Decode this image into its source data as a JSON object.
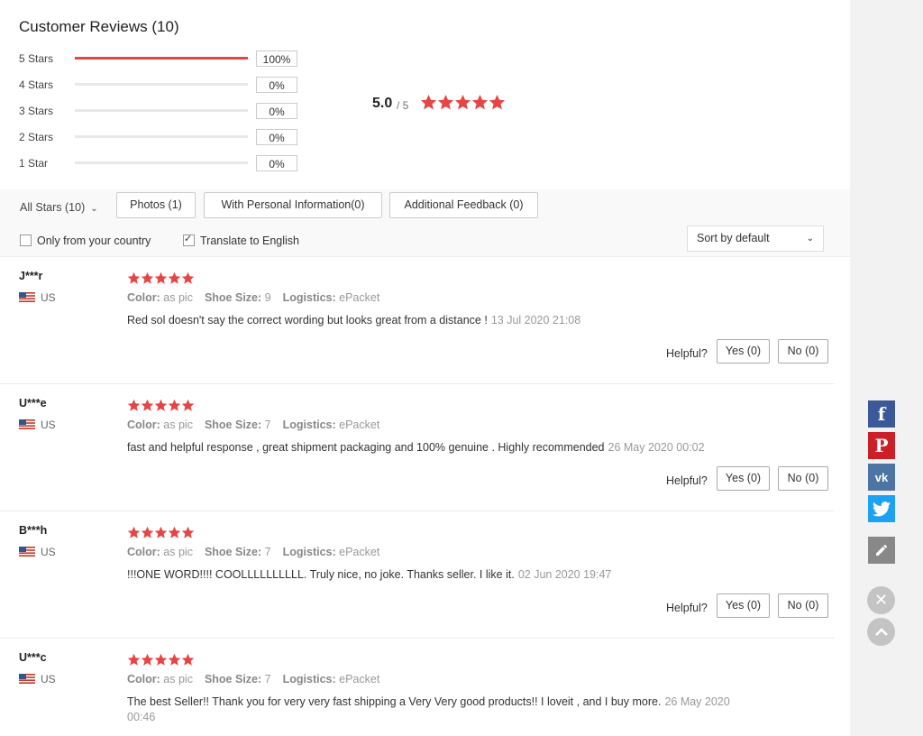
{
  "summary": {
    "title": "Customer Reviews (10)",
    "distribution": [
      {
        "label": "5 Stars",
        "percent_text": "100%",
        "fraction": 1.0
      },
      {
        "label": "4 Stars",
        "percent_text": "0%",
        "fraction": 0
      },
      {
        "label": "3 Stars",
        "percent_text": "0%",
        "fraction": 0
      },
      {
        "label": "2 Stars",
        "percent_text": "0%",
        "fraction": 0
      },
      {
        "label": "1 Star",
        "percent_text": "0%",
        "fraction": 0
      }
    ],
    "average": "5.0",
    "out_of": "/ 5",
    "star_rating": 5
  },
  "filters": {
    "all_stars": "All Stars (10)",
    "photos": "Photos (1)",
    "personal_info": "With Personal Information(0)",
    "additional_feedback": "Additional Feedback (0)",
    "only_country": "Only from your country",
    "only_country_checked": false,
    "translate": "Translate to English",
    "translate_checked": true,
    "sort": "Sort by default"
  },
  "labels": {
    "color": "Color:",
    "shoe_size": "Shoe Size:",
    "logistics": "Logistics:",
    "helpful": "Helpful?"
  },
  "reviews": [
    {
      "name": "J***r",
      "country": "US",
      "color": "as pic",
      "shoe_size": "9",
      "logistics": "ePacket",
      "text": "Red sol doesn't say the correct wording but looks great from a distance !",
      "date": "13 Jul 2020 21:08",
      "yes": "Yes (0)",
      "no": "No (0)"
    },
    {
      "name": "U***e",
      "country": "US",
      "color": "as pic",
      "shoe_size": "7",
      "logistics": "ePacket",
      "text": "fast and helpful response , great shipment packaging and 100% genuine . Highly recommended",
      "date": "26 May 2020 00:02",
      "yes": "Yes (0)",
      "no": "No (0)"
    },
    {
      "name": "B***h",
      "country": "US",
      "color": "as pic",
      "shoe_size": "7",
      "logistics": "ePacket",
      "text": "!!!ONE WORD!!!! COOLLLLLLLLLL. Truly nice, no joke. Thanks seller. I like it.",
      "date": "02 Jun 2020 19:47",
      "yes": "Yes (0)",
      "no": "No (0)"
    },
    {
      "name": "U***c",
      "country": "US",
      "color": "as pic",
      "shoe_size": "7",
      "logistics": "ePacket",
      "text": "The best Seller!! Thank you for very very fast shipping a Very Very good products!! I loveit , and I buy more.",
      "date": "26 May 2020 00:46",
      "yes": "Yes (0)",
      "no": "No (0)"
    }
  ],
  "social": {
    "facebook_color": "#3b5998",
    "pinterest_color": "#cb2027",
    "vk_color": "#4c75a3",
    "twitter_color": "#1da1f2",
    "edit_color": "#888888"
  },
  "colors": {
    "accent": "#e64545"
  }
}
